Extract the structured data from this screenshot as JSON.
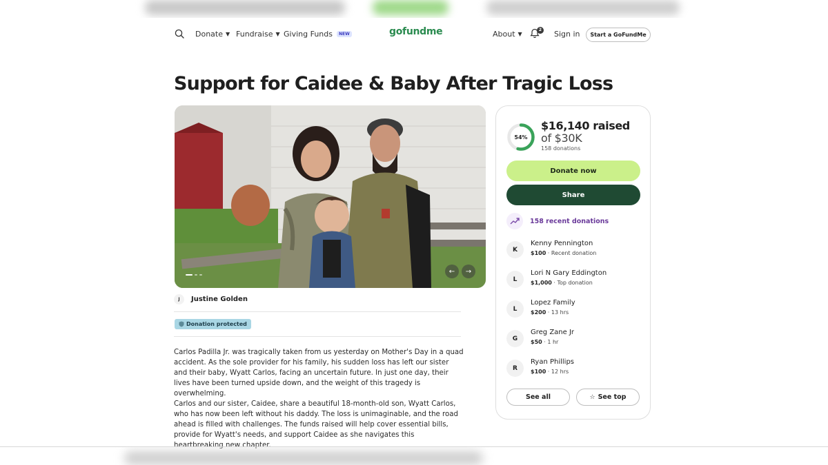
{
  "header": {
    "nav": [
      {
        "label": "Donate"
      },
      {
        "label": "Fundraise"
      },
      {
        "label": "Giving Funds",
        "badge": "NEW"
      }
    ],
    "logo_text": "gofundme",
    "about_label": "About",
    "notification_count": "2",
    "signin_label": "Sign in",
    "start_label": "Start a GoFundMe"
  },
  "campaign": {
    "title": "Support for Caidee & Baby After Tragic Loss",
    "organizer_initial": "J",
    "organizer_name": "Justine Golden",
    "protection_label": "Donation protected",
    "story": [
      "Carlos Padilla Jr. was tragically taken from us yesterday on Mother's Day in a quad accident. As the sole provider for his family, his sudden loss has left our sister and their baby, Wyatt Carlos, facing an uncertain future. In just one day, their lives have been turned upside down, and the weight of this tragedy is overwhelming.",
      "Carlos and our sister, Caidee, share a beautiful 18-month-old son, Wyatt Carlos, who has now been left without his daddy. The loss is unimaginable, and the road ahead is filled with challenges. The funds raised will help cover essential bills, provide for Wyatt's needs, and support Caidee as she navigates this heartbreaking new chapter."
    ]
  },
  "donation_card": {
    "progress_percent": 54,
    "progress_label": "54%",
    "raised": "$16,140 raised",
    "goal": "of $30K",
    "donation_count": "158 donations",
    "donate_label": "Donate now",
    "share_label": "Share",
    "recent_label": "158 recent donations",
    "donors": [
      {
        "initial": "K",
        "name": "Kenny Pennington",
        "amount": "$100",
        "note": " · Recent donation"
      },
      {
        "initial": "L",
        "name": "Lori N Gary Eddington",
        "amount": "$1,000",
        "note": " · Top donation"
      },
      {
        "initial": "L",
        "name": "Lopez Family",
        "amount": "$200",
        "note": " · 13 hrs"
      },
      {
        "initial": "G",
        "name": "Greg Zane Jr",
        "amount": "$50",
        "note": " · 1 hr"
      },
      {
        "initial": "R",
        "name": "Ryan Phillips",
        "amount": "$100",
        "note": " · 12 hrs"
      }
    ],
    "see_all_label": "See all",
    "see_top_label": "See top"
  },
  "colors": {
    "brand_green": "#2a8b4f",
    "donate_button": "#cbf08a",
    "share_button": "#1f4a33",
    "progress": "#3aa35a",
    "recent_purple": "#6a3a9a"
  },
  "icons": [
    "search-icon",
    "bell-icon",
    "trend-up-icon",
    "star-icon",
    "shield-icon",
    "arrow-left-icon",
    "arrow-right-icon"
  ]
}
